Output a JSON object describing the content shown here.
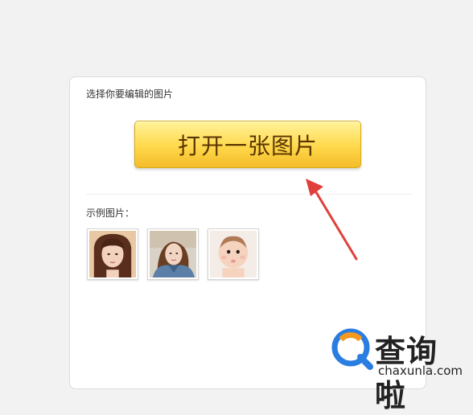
{
  "panel": {
    "prompt": "选择你要编辑的图片",
    "open_button_label": "打开一张图片",
    "examples_label": "示例图片：",
    "examples": [
      {
        "name": "example-photo-woman-bangs"
      },
      {
        "name": "example-photo-woman-denim"
      },
      {
        "name": "example-photo-baby"
      }
    ]
  },
  "watermark": {
    "brand": "查询啦",
    "domain": "chaxunla.com",
    "accent_blue": "#2a7de1",
    "accent_orange": "#f39a1e"
  },
  "colors": {
    "button_top": "#fff39a",
    "button_bottom": "#f4bc2a",
    "arrow": "#e0403a"
  }
}
